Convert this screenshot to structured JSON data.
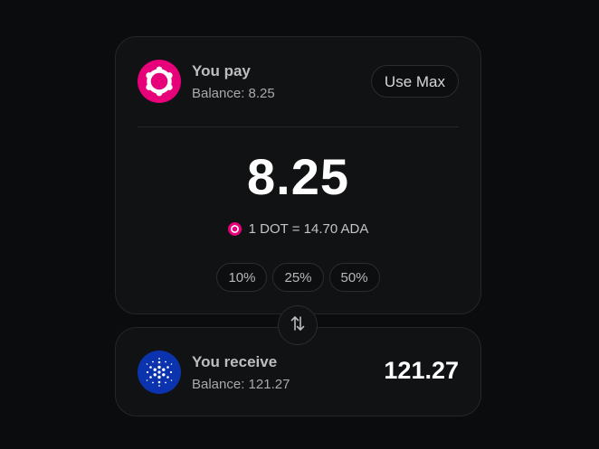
{
  "pay": {
    "label": "You pay",
    "balance": "Balance: 8.25",
    "use_max": "Use Max",
    "amount": "8.25",
    "rate": "1 DOT = 14.70 ADA",
    "token_icon": "polkadot-icon",
    "percent_options": [
      "10%",
      "25%",
      "50%"
    ]
  },
  "swap": {
    "icon": "swap-arrows-icon"
  },
  "receive": {
    "label": "You receive",
    "balance": "Balance: 121.27",
    "amount": "121.27",
    "token_icon": "cardano-icon"
  },
  "colors": {
    "background": "#0b0c0e",
    "card": "#111214",
    "polkadot_pink": "#e6007a",
    "cardano_blue": "#0b33ad"
  }
}
